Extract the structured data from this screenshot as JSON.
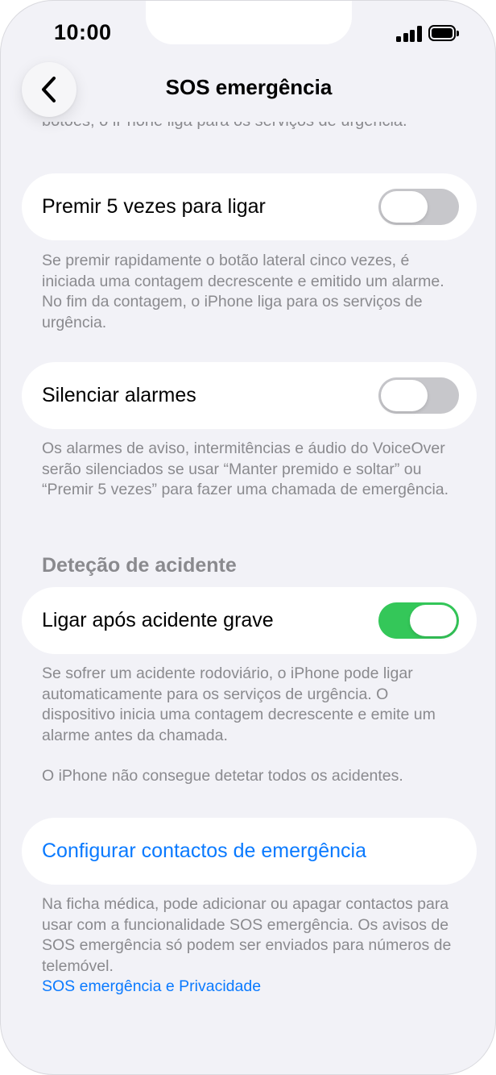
{
  "status_bar": {
    "time": "10:00"
  },
  "nav": {
    "title": "SOS emergência",
    "back_icon": "chevron-left-icon"
  },
  "top_cut_text": "botões, o iPhone liga para os serviços de urgência.",
  "press5": {
    "label": "Premir 5 vezes para ligar",
    "toggle_on": false,
    "footer": "Se premir rapidamente o botão lateral cinco vezes, é iniciada uma contagem decrescente e emitido um alarme. No fim da contagem, o iPhone liga para os serviços de urgência."
  },
  "silence": {
    "label": "Silenciar alarmes",
    "toggle_on": false,
    "footer": "Os alarmes de aviso, intermitências e áudio do VoiceOver serão silenciados se usar “Manter premido e soltar” ou “Premir 5 vezes” para fazer uma chamada de emergência."
  },
  "crash": {
    "header": "Deteção de acidente",
    "label": "Ligar após acidente grave",
    "toggle_on": true,
    "footer_1": "Se sofrer um acidente rodoviário, o iPhone pode ligar automaticamente para os serviços de urgência. O dispositivo inicia uma contagem decrescente e emite um alarme antes da chamada.",
    "footer_2": "O iPhone não consegue detetar todos os acidentes."
  },
  "contacts": {
    "label": "Configurar contactos de emergência",
    "footer": "Na ficha médica, pode adicionar ou apagar contactos para usar com a funcionalidade SOS emergência. Os avisos de SOS emergência só podem ser enviados para números de telemóvel.",
    "footer_link": "SOS emergência e Privacidade"
  },
  "colors": {
    "background": "#f2f2f7",
    "card": "#ffffff",
    "toggle_off": "#c7c7cb",
    "toggle_on": "#34c759",
    "link": "#0a7aff",
    "secondary_text": "#8a8a8e"
  }
}
